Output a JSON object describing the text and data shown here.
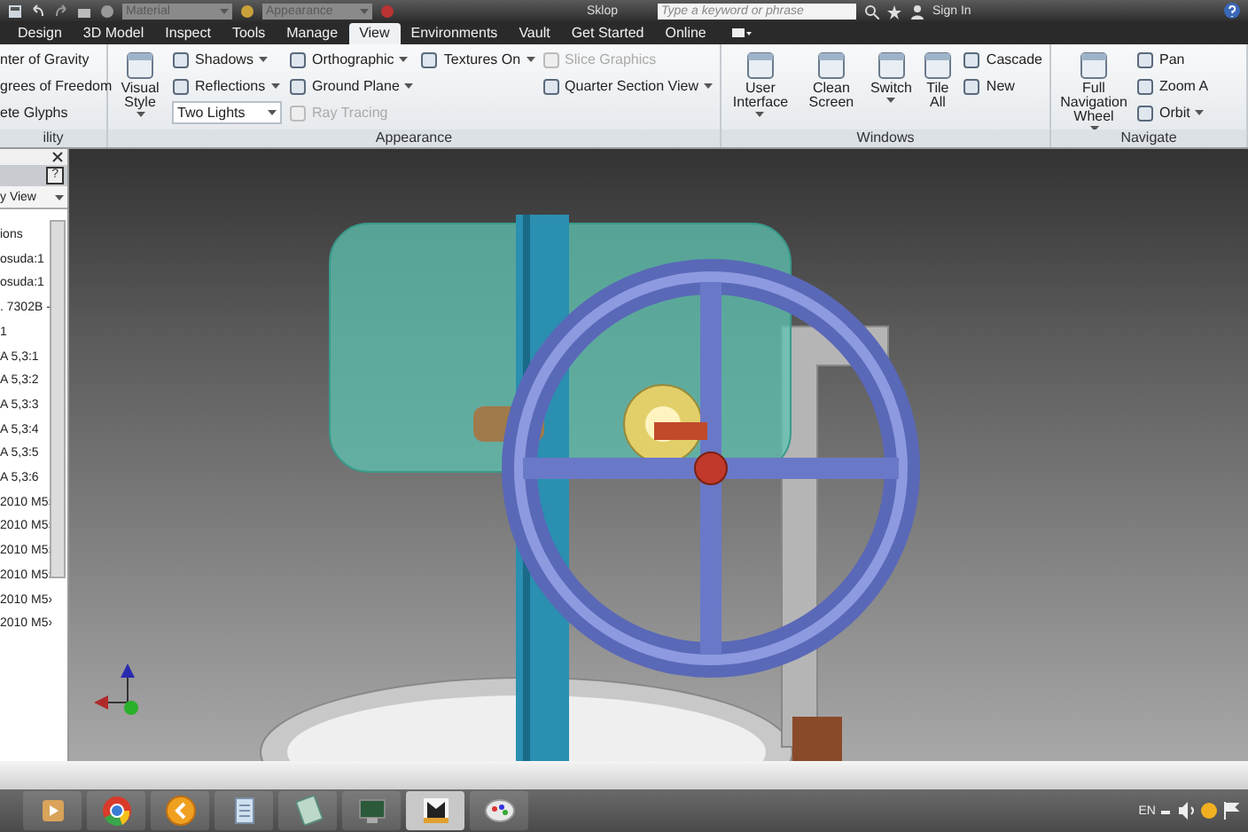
{
  "quick_access": {
    "material": "Material",
    "appearance": "Appearance",
    "document_title": "Sklop",
    "search": {
      "placeholder": "Type a keyword or phrase"
    },
    "sign_in": "Sign In"
  },
  "tabs": [
    {
      "label": "Design",
      "selected": false
    },
    {
      "label": "3D Model",
      "selected": false
    },
    {
      "label": "Inspect",
      "selected": false
    },
    {
      "label": "Tools",
      "selected": false
    },
    {
      "label": "Manage",
      "selected": false
    },
    {
      "label": "View",
      "selected": true
    },
    {
      "label": "Environments",
      "selected": false
    },
    {
      "label": "Vault",
      "selected": false
    },
    {
      "label": "Get Started",
      "selected": false
    },
    {
      "label": "Online",
      "selected": false
    }
  ],
  "ribbon": {
    "panels": [
      {
        "title": "ility",
        "columns": [
          [
            {
              "kind": "text",
              "label": "nter of Gravity"
            },
            {
              "kind": "text",
              "label": "grees of Freedom"
            },
            {
              "kind": "text",
              "label": "ete Glyphs"
            }
          ]
        ]
      },
      {
        "title": "Appearance",
        "columns": [
          [
            {
              "kind": "large",
              "label": "Visual Style",
              "dropdown": true
            }
          ],
          [
            {
              "kind": "small",
              "label": "Shadows",
              "dropdown": true,
              "disabled": false
            },
            {
              "kind": "small",
              "label": "Reflections",
              "dropdown": true,
              "disabled": false
            },
            {
              "kind": "select",
              "value": "Two Lights"
            }
          ],
          [
            {
              "kind": "small",
              "label": "Orthographic",
              "dropdown": true,
              "disabled": false
            },
            {
              "kind": "small",
              "label": "Ground Plane",
              "dropdown": true,
              "disabled": false
            },
            {
              "kind": "small",
              "label": "Ray Tracing",
              "dropdown": false,
              "disabled": true
            }
          ],
          [
            {
              "kind": "small",
              "label": "Textures On",
              "dropdown": true,
              "disabled": false
            }
          ],
          [
            {
              "kind": "small",
              "label": "Slice Graphics",
              "dropdown": false,
              "disabled": true
            },
            {
              "kind": "small",
              "label": "Quarter Section View",
              "dropdown": true,
              "disabled": false
            }
          ]
        ]
      },
      {
        "title": "Windows",
        "columns": [
          [
            {
              "kind": "large",
              "label": "User Interface",
              "dropdown": true
            }
          ],
          [
            {
              "kind": "large",
              "label": "Clean Screen",
              "dropdown": false
            }
          ],
          [
            {
              "kind": "large",
              "label": "Switch",
              "dropdown": true
            }
          ],
          [
            {
              "kind": "large",
              "label": "Tile All",
              "dropdown": false
            }
          ],
          [
            {
              "kind": "small",
              "label": "Cascade",
              "dropdown": false,
              "disabled": false
            },
            {
              "kind": "small",
              "label": "New",
              "dropdown": false,
              "disabled": false
            }
          ]
        ]
      },
      {
        "title": "Navigate",
        "columns": [
          [
            {
              "kind": "large",
              "label": "Full Navigation Wheel",
              "dropdown": true
            }
          ],
          [
            {
              "kind": "small",
              "label": "Pan",
              "dropdown": false,
              "disabled": false
            },
            {
              "kind": "small",
              "label": "Zoom A",
              "dropdown": false,
              "disabled": false
            },
            {
              "kind": "small",
              "label": "Orbit",
              "dropdown": true,
              "disabled": false
            }
          ]
        ]
      }
    ]
  },
  "browser": {
    "help_button": "?",
    "view_dropdown": "y View",
    "items": [
      "ions",
      "osuda:1",
      "osuda:1",
      ". 7302B -",
      "1",
      "A 5,3:1",
      "A 5,3:2",
      "A 5,3:3",
      "A 5,3:4",
      "A 5,3:5",
      "A 5,3:6",
      "2010 M5›",
      "2010 M5›",
      "2010 M5›",
      "2010 M5›",
      "2010 M5›",
      "2010 M5›"
    ]
  },
  "taskbar": {
    "apps": [
      {
        "selected": false
      },
      {
        "selected": false
      },
      {
        "selected": false
      },
      {
        "selected": false
      },
      {
        "selected": false
      },
      {
        "selected": false
      },
      {
        "selected": true
      },
      {
        "selected": false
      }
    ],
    "language": "EN"
  }
}
